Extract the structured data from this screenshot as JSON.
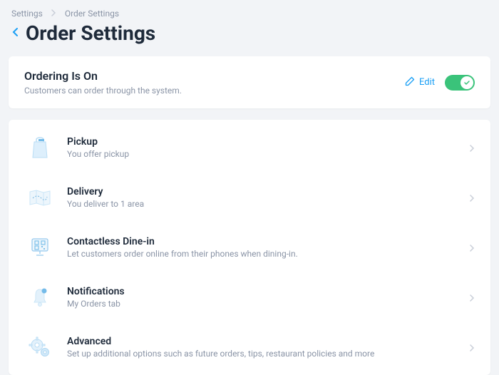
{
  "breadcrumb": {
    "root": "Settings",
    "current": "Order Settings"
  },
  "page_title": "Order Settings",
  "ordering": {
    "title": "Ordering Is On",
    "subtitle": "Customers can order through the system.",
    "edit_label": "Edit",
    "toggle_on": true
  },
  "items": [
    {
      "icon": "bag-icon",
      "title": "Pickup",
      "subtitle": "You offer pickup"
    },
    {
      "icon": "map-icon",
      "title": "Delivery",
      "subtitle": "You deliver to 1 area"
    },
    {
      "icon": "qr-screen-icon",
      "title": "Contactless Dine-in",
      "subtitle": "Let customers order online from their phones when dining-in."
    },
    {
      "icon": "bell-icon",
      "title": "Notifications",
      "subtitle": "My Orders tab"
    },
    {
      "icon": "gears-icon",
      "title": "Advanced",
      "subtitle": "Set up additional options such as future orders, tips, restaurant policies and more"
    }
  ]
}
